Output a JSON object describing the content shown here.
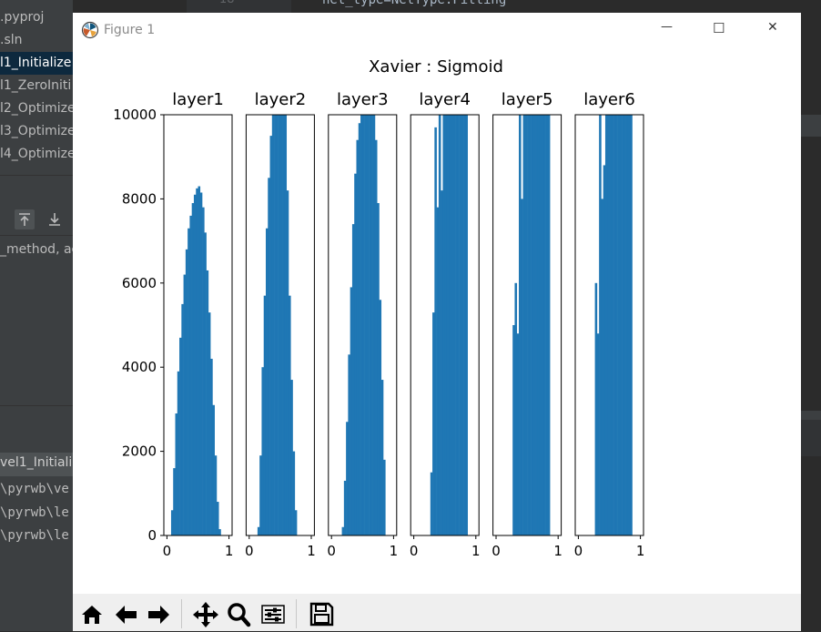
{
  "ide": {
    "code_fragment": "net_type=NetType.Fitting",
    "line_number": "18",
    "files": [
      ".pyproj",
      ".sln",
      "l1_Initialize",
      "l1_ZeroIniti",
      "l2_Optimize",
      "l3_Optimize",
      "l4_Optimize"
    ],
    "method_text": "_method, ac",
    "tab_label": "vel1_Initiali",
    "console_lines": [
      "\\pyrwb\\ve",
      "\\pyrwb\\le",
      "\\pyrwb\\le"
    ]
  },
  "window": {
    "title": "Figure 1",
    "minimize_glyph": "—",
    "maximize_glyph": "☐",
    "close_glyph": "✕"
  },
  "chart_data": {
    "type": "bar",
    "title": "Xavier : Sigmoid",
    "ylim": [
      0,
      10000
    ],
    "yticks": [
      0,
      2000,
      4000,
      6000,
      8000,
      10000
    ],
    "xlim": [
      -0.05,
      1.05
    ],
    "xticks": [
      0,
      1
    ],
    "bins": 30,
    "bin_range": [
      0,
      1
    ],
    "color": "#1f77b4",
    "subplots": [
      {
        "label": "layer1",
        "values": [
          0,
          0,
          600,
          1600,
          2900,
          3900,
          4700,
          5500,
          6200,
          6800,
          7300,
          7600,
          7900,
          8100,
          8250,
          8300,
          8150,
          7800,
          7200,
          6300,
          5300,
          4200,
          3100,
          1900,
          800,
          150,
          0,
          0,
          0,
          0
        ]
      },
      {
        "label": "layer2",
        "values": [
          0,
          0,
          0,
          0,
          200,
          1900,
          4000,
          5700,
          7300,
          8500,
          9500,
          10000,
          10000,
          10000,
          10000,
          10000,
          10000,
          10000,
          8200,
          5700,
          3700,
          2000,
          600,
          0,
          0,
          0,
          0,
          0,
          0,
          0
        ]
      },
      {
        "label": "layer3",
        "values": [
          0,
          0,
          0,
          0,
          0,
          200,
          1300,
          2700,
          4300,
          5900,
          7400,
          8600,
          9400,
          9800,
          10000,
          10000,
          10000,
          10000,
          10000,
          10000,
          10000,
          9400,
          7900,
          5600,
          3700,
          1800,
          0,
          0,
          0,
          0
        ]
      },
      {
        "label": "layer4",
        "values": [
          0,
          0,
          0,
          0,
          0,
          0,
          0,
          0,
          1500,
          5300,
          9700,
          7800,
          10000,
          8200,
          10000,
          10000,
          10000,
          10000,
          10000,
          10000,
          10000,
          10000,
          10000,
          10000,
          10000,
          10000,
          0,
          0,
          0,
          0
        ]
      },
      {
        "label": "layer5",
        "values": [
          0,
          0,
          0,
          0,
          0,
          0,
          0,
          0,
          5000,
          6000,
          4800,
          10000,
          8000,
          10000,
          10000,
          10000,
          10000,
          10000,
          10000,
          10000,
          10000,
          10000,
          10000,
          10000,
          10000,
          10000,
          0,
          0,
          0,
          0
        ]
      },
      {
        "label": "layer6",
        "values": [
          0,
          0,
          0,
          0,
          0,
          0,
          0,
          0,
          6000,
          4800,
          10000,
          8000,
          8800,
          10000,
          10000,
          10000,
          10000,
          10000,
          10000,
          10000,
          10000,
          10000,
          10000,
          10000,
          10000,
          10000,
          0,
          0,
          0,
          0
        ]
      }
    ]
  },
  "toolbar": {
    "buttons": [
      {
        "name": "home",
        "icon": "home-icon"
      },
      {
        "name": "back",
        "icon": "arrow-left-icon"
      },
      {
        "name": "forward",
        "icon": "arrow-right-icon"
      },
      {
        "name": "pan",
        "icon": "move-icon"
      },
      {
        "name": "zoom",
        "icon": "magnifier-icon"
      },
      {
        "name": "configure",
        "icon": "sliders-icon"
      },
      {
        "name": "save",
        "icon": "floppy-disk-icon"
      }
    ]
  }
}
